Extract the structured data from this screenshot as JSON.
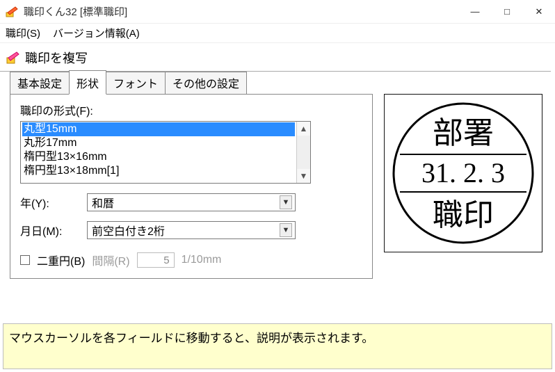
{
  "window": {
    "title": "職印くん32 [標準職印]"
  },
  "menu": {
    "stamp": "職印(S)",
    "about": "バージョン情報(A)"
  },
  "toolrow": {
    "copy_label": "職印を複写"
  },
  "tabs": {
    "basic": "基本設定",
    "shape": "形状",
    "font": "フォント",
    "other": "その他の設定"
  },
  "shape_panel": {
    "format_label": "職印の形式(F):",
    "format_options": [
      "丸型15mm",
      "丸形17mm",
      "楕円型13×16mm",
      "楕円型13×18mm[1]"
    ],
    "year_label": "年(Y):",
    "year_value": "和暦",
    "monthday_label": "月日(M):",
    "monthday_value": "前空白付き2桁",
    "double_circle_label": "二重円(B)",
    "gap_label": "間隔(R)",
    "gap_value": "5",
    "gap_unit": "1/10mm"
  },
  "preview": {
    "top_text": "部署",
    "date_text": "31.  2.  3",
    "bottom_text": "職印"
  },
  "status": {
    "text": "マウスカーソルを各フィールドに移動すると、説明が表示されます。"
  }
}
